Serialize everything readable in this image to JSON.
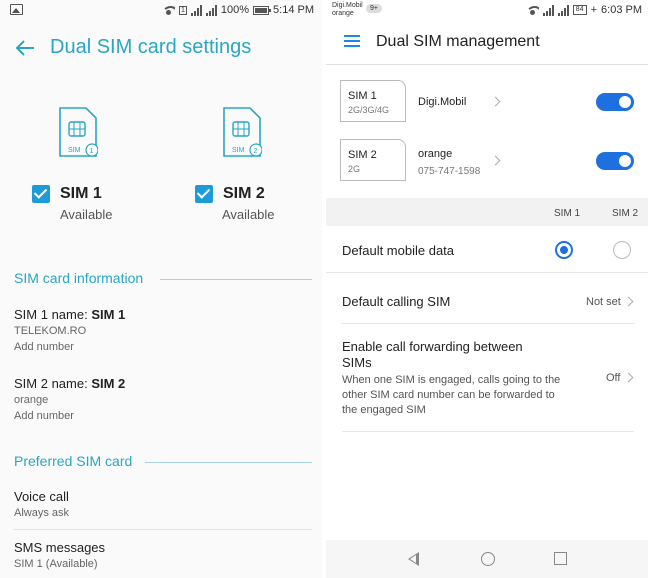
{
  "left": {
    "status": {
      "battery": "100%",
      "time": "5:14 PM",
      "sim_marker": "1"
    },
    "header": {
      "title": "Dual SIM card settings"
    },
    "sims": [
      {
        "card_label": "SIM",
        "card_number": "1",
        "name": "SIM 1",
        "status": "Available",
        "checked": true
      },
      {
        "card_label": "SIM",
        "card_number": "2",
        "name": "SIM 2",
        "status": "Available",
        "checked": true
      }
    ],
    "sim_info": {
      "heading": "SIM card information",
      "items": [
        {
          "prefix": "SIM 1 name: ",
          "name": "SIM 1",
          "carrier": "TELEKOM.RO",
          "action": "Add number"
        },
        {
          "prefix": "SIM 2 name: ",
          "name": "SIM 2",
          "carrier": "orange",
          "action": "Add number"
        }
      ]
    },
    "preferred": {
      "heading": "Preferred SIM card",
      "items": [
        {
          "title": "Voice call",
          "value": "Always ask"
        },
        {
          "title": "SMS messages",
          "value": "SIM 1 (Available)"
        }
      ]
    }
  },
  "right": {
    "status": {
      "carrier1": "Digi.Mobil",
      "carrier2": "orange",
      "notif_badge": "9+",
      "battery": "84",
      "time": "6:03 PM"
    },
    "header": {
      "title": "Dual SIM management"
    },
    "sims": [
      {
        "box_name": "SIM 1",
        "box_type": "2G/3G/4G",
        "carrier": "Digi.Mobil",
        "number": "",
        "enabled": true
      },
      {
        "box_name": "SIM 2",
        "box_type": "2G",
        "carrier": "orange",
        "number": "075-747-1598",
        "enabled": true
      }
    ],
    "columns": {
      "col1": "SIM 1",
      "col2": "SIM 2"
    },
    "default_data": {
      "label": "Default mobile data",
      "selected": "SIM 1"
    },
    "default_calling": {
      "label": "Default calling SIM",
      "value": "Not set"
    },
    "forwarding": {
      "label": "Enable call forwarding between SIMs",
      "description": "When one SIM is engaged, calls going to the other SIM card number can be forwarded to the engaged SIM",
      "value": "Off"
    }
  },
  "colors": {
    "left_accent": "#29a6c3",
    "checkbox": "#1e9bd7",
    "right_accent": "#1e6fe0"
  }
}
